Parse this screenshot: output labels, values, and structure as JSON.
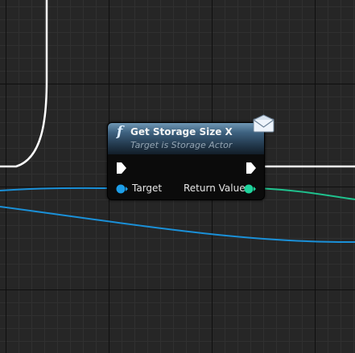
{
  "node": {
    "icon": "function-icon",
    "icon_glyph": "f",
    "title": "Get Storage Size X",
    "subtitle": "Target is Storage Actor",
    "message_icon": "envelope-icon",
    "input_pins": [
      {
        "type": "exec"
      },
      {
        "type": "object",
        "label": "Target",
        "color": "#1d9ee8"
      }
    ],
    "output_pins": [
      {
        "type": "exec"
      },
      {
        "type": "integer",
        "label": "Return Value",
        "color": "#1fd39c"
      }
    ]
  },
  "colors": {
    "exec_wire": "#ffffff",
    "object_wire": "#1a90d8",
    "integer_wire": "#1fc28e",
    "grid_background": "#262626"
  }
}
